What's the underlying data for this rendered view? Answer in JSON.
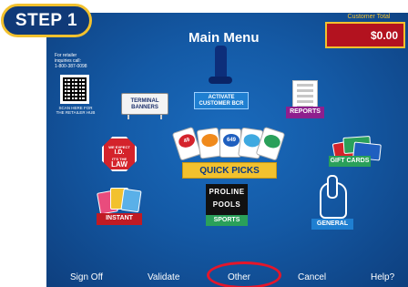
{
  "step_badge": "STEP 1",
  "header": {
    "title": "Main Menu",
    "customer_total_label": "Customer Total",
    "customer_total_value": "$0.00"
  },
  "retailer_info": {
    "line1": "For retailer",
    "line2": "inquiries call:",
    "phone": "1-800-387-0098",
    "scan_line1": "SCAN HERE FOR",
    "scan_line2": "THE RETAILER HUB"
  },
  "tiles": {
    "terminal_banners": {
      "line1": "TERMINAL",
      "line2": "BANNERS"
    },
    "activate_bcr": {
      "line1": "ACTIVATE",
      "line2": "CUSTOMER BCR"
    },
    "reports": {
      "label": "REPORTS"
    },
    "law": {
      "line1": "WE EXPECT",
      "line2": "I.D.",
      "line3": "IT'S THE",
      "line4": "LAW"
    },
    "quick_picks": {
      "label": "QUICK PICKS",
      "card_logos": [
        "49",
        "",
        "649",
        "",
        ""
      ]
    },
    "gift_cards": {
      "label": "GIFT CARDS"
    },
    "instant": {
      "label": "INSTANT"
    },
    "proline": {
      "line1": "PROLINE",
      "line2": "POOLS",
      "label": "SPORTS"
    },
    "general": {
      "label": "GENERAL"
    }
  },
  "bottom_nav": {
    "sign_off": "Sign Off",
    "validate": "Validate",
    "other": "Other",
    "cancel": "Cancel",
    "help": "Help?"
  },
  "colors": {
    "background": "#145aa6",
    "highlight_ring": "#e5162a",
    "badge_border": "#f2c12e",
    "total_box": "#b3121f"
  }
}
